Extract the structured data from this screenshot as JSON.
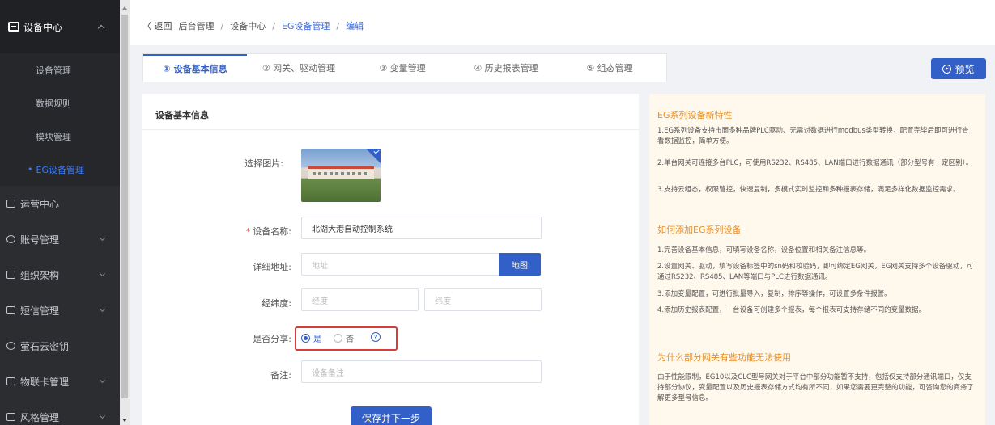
{
  "sidebar": {
    "header": "设备中心",
    "subitems": [
      "设备管理",
      "数据规则",
      "模块管理",
      "EG设备管理"
    ],
    "items": [
      "运营中心",
      "账号管理",
      "组织架构",
      "短信管理",
      "萤石云密钥",
      "物联卡管理",
      "风格管理"
    ]
  },
  "breadcrumb": {
    "back": "〈 返回",
    "items": [
      "后台管理",
      "设备中心",
      "EG设备管理",
      "编辑"
    ],
    "separator": "/"
  },
  "tabs": [
    "① 设备基本信息",
    "② 网关、驱动管理",
    "③ 变量管理",
    "④ 历史报表管理",
    "⑤ 组态管理"
  ],
  "preview_button": "预览",
  "form": {
    "section_title": "设备基本信息",
    "image_label": "选择图片:",
    "name_label": "设备名称:",
    "name_required": "*",
    "name_value": "北湖大港自动控制系统",
    "address_label": "详细地址:",
    "address_placeholder": "地址",
    "map_button": "地图",
    "coords_label": "经纬度:",
    "longitude_placeholder": "经度",
    "latitude_placeholder": "纬度",
    "share_label": "是否分享:",
    "share_yes": "是",
    "share_no": "否",
    "share_selected": "是",
    "remark_label": "备注:",
    "remark_placeholder": "设备备注",
    "save_button": "保存并下一步"
  },
  "info": {
    "h1": "EG系列设备新特性",
    "p1": "1.EG系列设备支持市面多种品牌PLC驱动、无需对数据进行modbus类型转换，配置完毕后即可进行查看数据监控，简单方便。",
    "p2": "2.单台网关可连接多台PLC，可使用RS232、RS485、LAN端口进行数据通讯（部分型号有一定区别）。",
    "p3": "3.支持云组态，权限管控，快速复制，多模式实时监控和多种报表存储，满足多样化数据监控需求。",
    "h2": "如何添加EG系列设备",
    "p4": "1.完善设备基本信息，可填写设备名称，设备位置和相关备注信息等。",
    "p5": "2.设置网关、驱动，填写设备标签中的sn码和校验码，即可绑定EG网关，EG网关支持多个设备驱动，可通过RS232、RS485、LAN等端口与PLC进行数据通讯。",
    "p6": "3.添加变量配置，可进行批量导入，复制，排序等操作，可设置多条件报警。",
    "p7": "4.添加历史报表配置，一台设备可创建多个报表，每个报表可支持存储不同的变量数据。",
    "h3": "为什么部分网关有些功能无法使用",
    "p8": "由于性能限制，EG10以及CLC型号网关对于平台中部分功能暂不支持，包括仅支持部分通讯端口，仅支持部分协议，变量配置以及历史报表存储方式均有所不同，如果您需要更完整的功能，可咨询您的商务了解更多型号信息。"
  },
  "colors": {
    "accent": "#3360c8",
    "sidebar": "#2b2d31",
    "highlight": "#d93a3a",
    "info_heading": "#e8902a"
  }
}
